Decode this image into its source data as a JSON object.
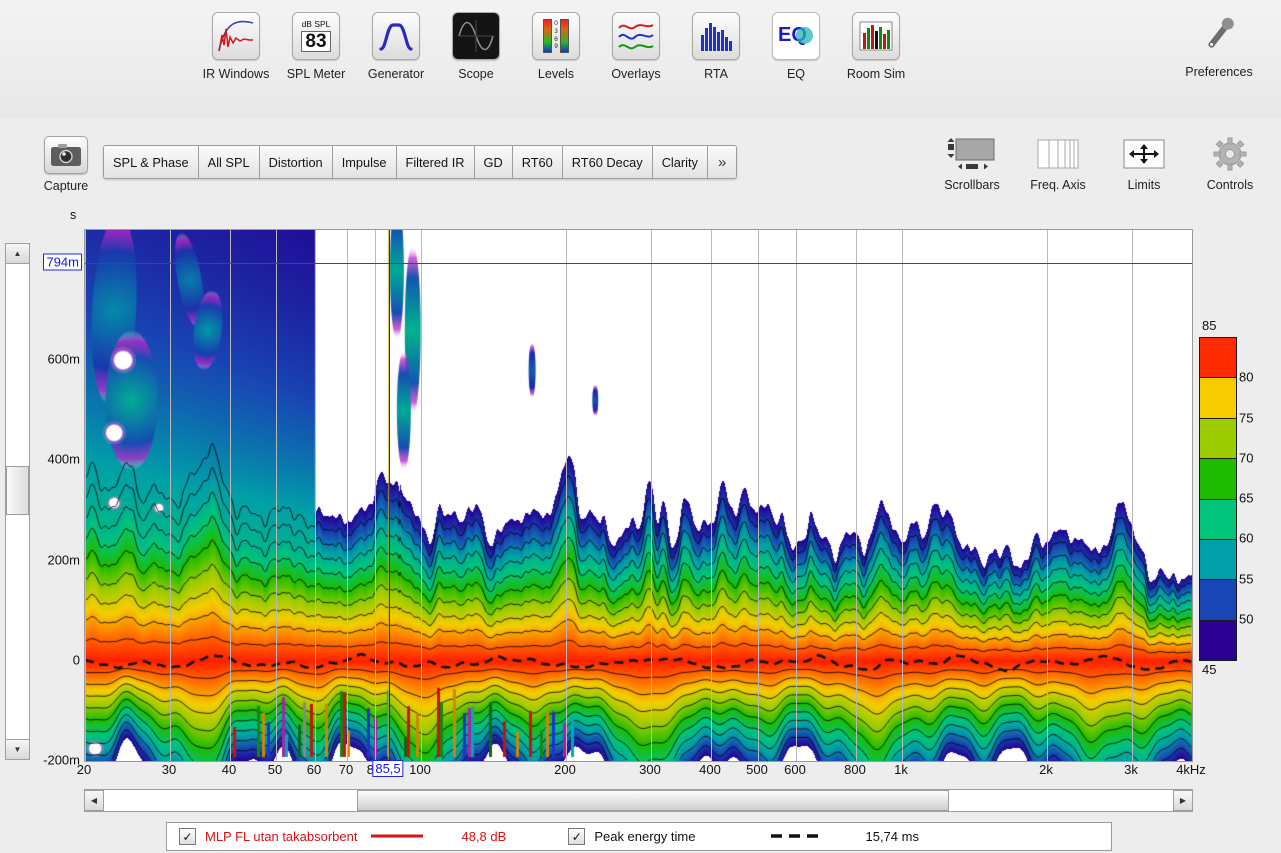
{
  "toolbar": {
    "items": [
      {
        "label": "IR Windows",
        "icon": "ir-windows-icon"
      },
      {
        "label": "SPL Meter",
        "icon": "spl-meter-icon",
        "big": "83",
        "small": "dB SPL"
      },
      {
        "label": "Generator",
        "icon": "generator-icon"
      },
      {
        "label": "Scope",
        "icon": "scope-icon"
      },
      {
        "label": "Levels",
        "icon": "levels-icon",
        "digits": [
          "0",
          "3",
          "6",
          "9"
        ]
      },
      {
        "label": "Overlays",
        "icon": "overlays-icon"
      },
      {
        "label": "RTA",
        "icon": "rta-icon"
      },
      {
        "label": "EQ",
        "icon": "eq-icon",
        "text": "EQ"
      },
      {
        "label": "Room Sim",
        "icon": "room-sim-icon"
      }
    ],
    "preferences": {
      "label": "Preferences",
      "icon": "wrench-icon"
    }
  },
  "subbar": {
    "capture": {
      "label": "Capture",
      "icon": "camera-icon"
    },
    "tabs": [
      {
        "label": "SPL & Phase"
      },
      {
        "label": "All SPL"
      },
      {
        "label": "Distortion"
      },
      {
        "label": "Impulse"
      },
      {
        "label": "Filtered IR"
      },
      {
        "label": "GD"
      },
      {
        "label": "RT60"
      },
      {
        "label": "RT60 Decay"
      },
      {
        "label": "Clarity"
      },
      {
        "label": "»"
      }
    ],
    "right_tools": [
      {
        "label": "Scrollbars",
        "icon": "scrollbars-icon"
      },
      {
        "label": "Freq. Axis",
        "icon": "freq-axis-icon"
      },
      {
        "label": "Limits",
        "icon": "limits-icon"
      },
      {
        "label": "Controls",
        "icon": "gear-icon"
      }
    ]
  },
  "chart_data": {
    "type": "heatmap",
    "title": "",
    "xlabel": "",
    "ylabel": "s",
    "y_unit_label": "s",
    "x_scale": "log",
    "xlim": [
      20,
      4000
    ],
    "ylim": [
      -0.2,
      0.86
    ],
    "grid": true,
    "xtick_labels": [
      "20",
      "30",
      "40",
      "50",
      "60",
      "70",
      "80",
      "100",
      "200",
      "300",
      "400",
      "500",
      "600",
      "800",
      "1k",
      "2k",
      "3k",
      "4kHz"
    ],
    "xtick_values": [
      20,
      30,
      40,
      50,
      60,
      70,
      80,
      100,
      200,
      300,
      400,
      500,
      600,
      800,
      1000,
      2000,
      3000,
      4000
    ],
    "ytick_labels": [
      "600m",
      "400m",
      "200m",
      "0",
      "-200m"
    ],
    "ytick_values": [
      0.6,
      0.4,
      0.2,
      0.0,
      -0.2
    ],
    "cursor": {
      "x_label": "85,5",
      "x_value": 85.5,
      "y_label": "794m",
      "y_value": 0.794
    },
    "colorbar": {
      "label_top": "85",
      "label_bottom": "45",
      "ticks": [
        "80",
        "75",
        "70",
        "65",
        "60",
        "55",
        "50"
      ],
      "tick_values": [
        80,
        75,
        70,
        65,
        60,
        55,
        50
      ],
      "range": [
        45,
        85
      ],
      "colors": [
        "#ff2a00",
        "#f5cc00",
        "#9ccc00",
        "#1fbb00",
        "#00c47a",
        "#00a0a8",
        "#1846b4",
        "#2a0090"
      ]
    }
  },
  "scrollbars": {
    "vertical": {
      "up": "▲",
      "down": "▼"
    },
    "horizontal": {
      "left": "◀",
      "right": "▶"
    }
  },
  "bottom_legend": {
    "entries": [
      {
        "checked": "✓",
        "name": "MLP FL utan takabsorbent",
        "color": "#dd1111",
        "style": "solid",
        "value": "48,8 dB"
      },
      {
        "checked": "✓",
        "name": "Peak energy time",
        "color": "#111111",
        "style": "dashed",
        "value": "15,74 ms"
      }
    ]
  }
}
